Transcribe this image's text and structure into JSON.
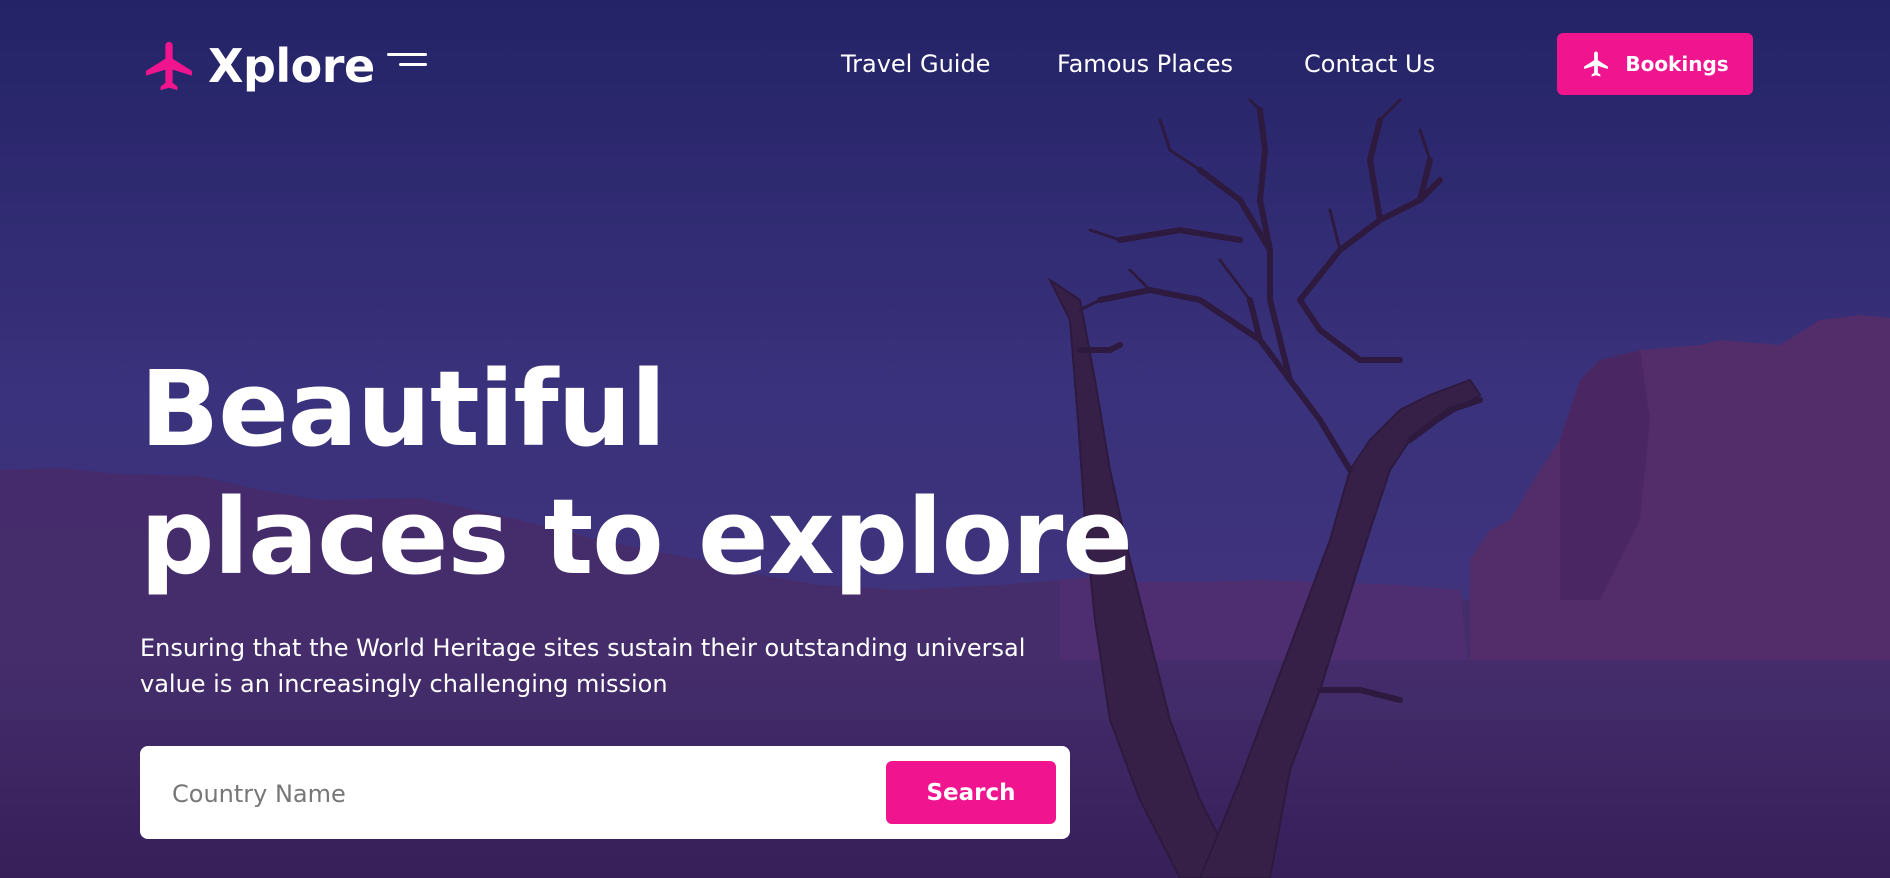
{
  "brand": {
    "name": "Xplore",
    "icon": "airplane-icon",
    "accent": "#f0148e"
  },
  "nav": {
    "links": [
      {
        "label": "Travel Guide"
      },
      {
        "label": "Famous Places"
      },
      {
        "label": "Contact Us"
      }
    ],
    "bookings_label": "Bookings"
  },
  "hero": {
    "title_line1": "Beautiful",
    "title_line2": "places to explore",
    "subtitle_line1": "Ensuring that the World Heritage sites sustain their outstanding universal",
    "subtitle_line2": "value is an increasingly challenging mission"
  },
  "search": {
    "placeholder": "Country Name",
    "button_label": "Search"
  },
  "colors": {
    "overlay": "#2a2466",
    "accent": "#f0148e"
  }
}
